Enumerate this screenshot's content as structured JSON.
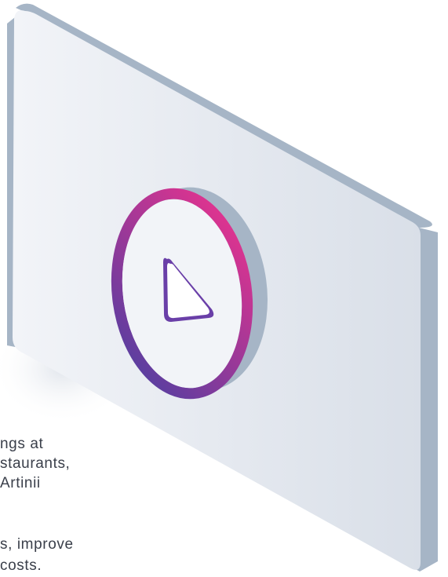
{
  "illustration": {
    "icon": "play-icon",
    "colors": {
      "panel_face_light": "#f2f4f8",
      "panel_face_dark": "#d9dfe8",
      "panel_side": "#a6b5c6",
      "ring_start": "#5a3ea0",
      "ring_end": "#e0338f",
      "ring_shadow": "#a6b5c6",
      "play_fill": "#ffffff"
    }
  },
  "text_fragments": {
    "line_1": "ngs at",
    "line_2": "staurants,",
    "line_3": "Artinii",
    "line_4": "s, improve",
    "line_5": "costs."
  }
}
